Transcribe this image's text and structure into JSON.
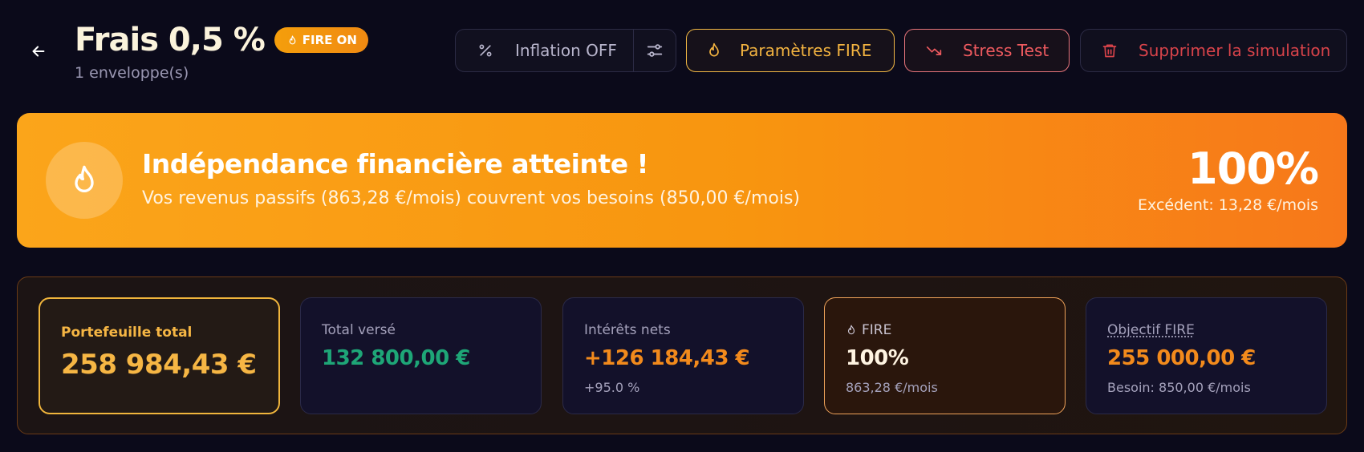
{
  "header": {
    "title": "Frais 0,5 %",
    "badge": "FIRE ON",
    "subtitle": "1 enveloppe(s)"
  },
  "toolbar": {
    "inflation_label": "Inflation OFF",
    "fire_params_label": "Paramètres FIRE",
    "stress_test_label": "Stress Test",
    "delete_label": "Supprimer la simulation"
  },
  "banner": {
    "title": "Indépendance financière atteinte !",
    "text": "Vos revenus passifs (863,28 €/mois) couvrent vos besoins (850,00 €/mois)",
    "percent": "100%",
    "surplus": "Excédent: 13,28 €/mois"
  },
  "stats": {
    "portfolio": {
      "label": "Portefeuille total",
      "value": "258 984,43 €"
    },
    "total_verse": {
      "label": "Total versé",
      "value": "132 800,00 €"
    },
    "interets": {
      "label": "Intérêts nets",
      "value": "+126 184,43 €",
      "sub": "+95.0 %"
    },
    "fire": {
      "label": "FIRE",
      "value": "100%",
      "sub": "863,28 €/mois"
    },
    "objectif": {
      "label": "Objectif FIRE",
      "value": "255 000,00 €",
      "sub": "Besoin: 850,00 €/mois"
    }
  },
  "colors": {
    "background": "#0b0a1a",
    "accent_orange": "#f28a1c",
    "accent_gold": "#f6b644",
    "green": "#1ea677",
    "red": "#ee5a5f"
  },
  "icons": {
    "back": "arrow-left-icon",
    "percent": "percent-icon",
    "sliders": "sliders-icon",
    "flame": "flame-icon",
    "trend_down": "trending-down-icon",
    "trash": "trash-icon"
  }
}
